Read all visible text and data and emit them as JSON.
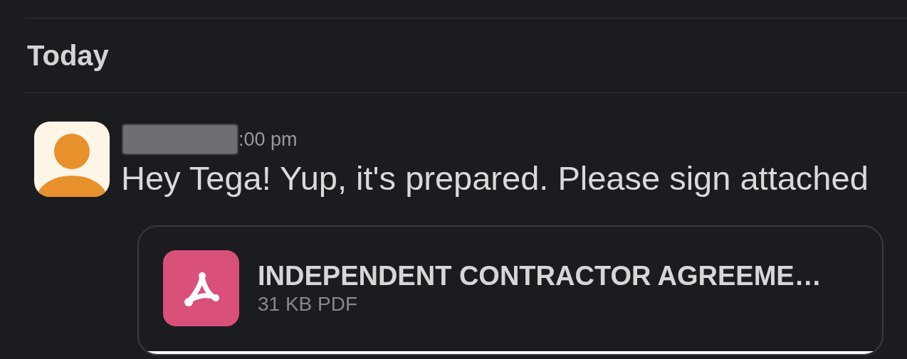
{
  "day_divider": {
    "label": "Today"
  },
  "message": {
    "time": ":00 pm",
    "sender_redacted": true,
    "text": "Hey Tega! Yup, it's prepared. Please sign attached",
    "attachment": {
      "title": "INDEPENDENT CONTRACTOR AGREEME…",
      "meta": "31 KB PDF"
    }
  }
}
